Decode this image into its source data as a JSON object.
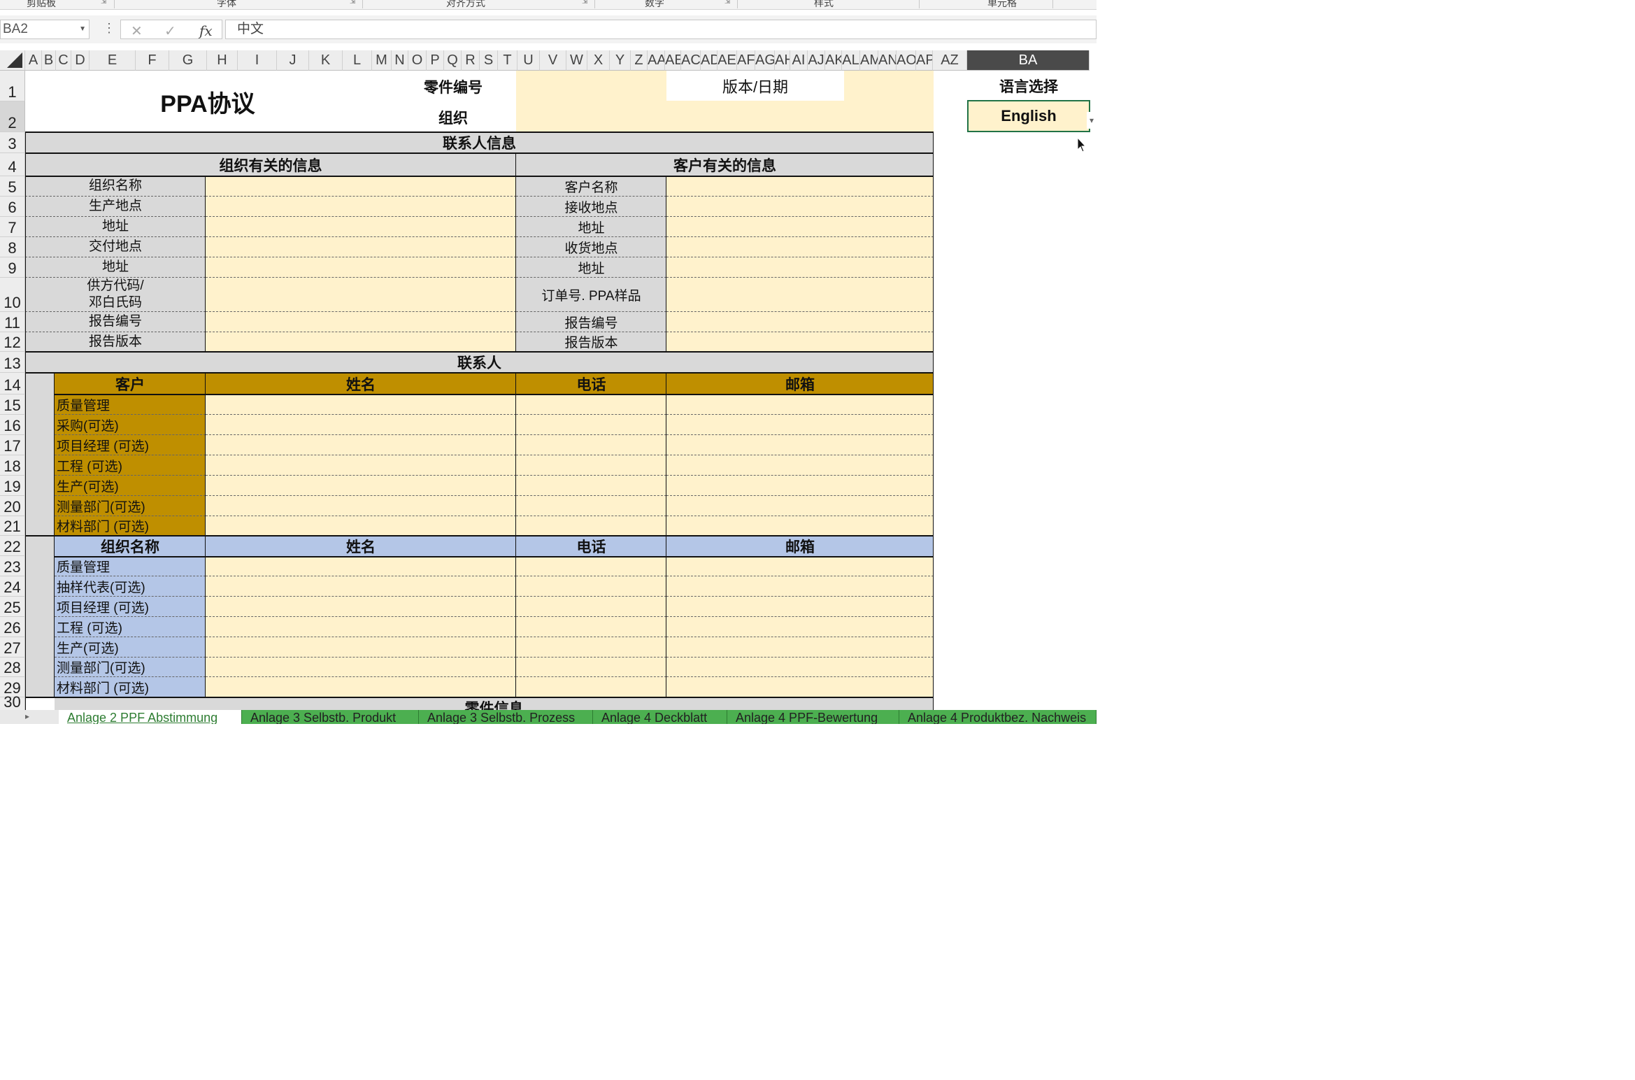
{
  "ribbon": {
    "groups": [
      "剪贴板",
      "字体",
      "对齐方式",
      "数字",
      "样式",
      "单元格"
    ]
  },
  "formula_bar": {
    "name_box": "BA2",
    "content": "中文",
    "fx": "fx"
  },
  "columns": [
    "A",
    "B",
    "C",
    "D",
    "E",
    "F",
    "G",
    "H",
    "I",
    "J",
    "K",
    "L",
    "M",
    "N",
    "O",
    "P",
    "Q",
    "R",
    "S",
    "T",
    "U",
    "V",
    "W",
    "X",
    "Y",
    "Z",
    "AA",
    "AE",
    "AC",
    "AD",
    "AE",
    "AF",
    "AG",
    "AH",
    "AI",
    "AJ",
    "AK",
    "AL",
    "AM",
    "AN",
    "AO",
    "AP",
    "AZ",
    "BA"
  ],
  "rows": [
    "1",
    "2",
    "3",
    "4",
    "5",
    "6",
    "7",
    "8",
    "9",
    "10",
    "11",
    "12",
    "13",
    "14",
    "15",
    "16",
    "17",
    "18",
    "19",
    "20",
    "21",
    "22",
    "23",
    "24",
    "25",
    "26",
    "27",
    "28",
    "29",
    "30"
  ],
  "header": {
    "title": "PPA协议",
    "part_no_label": "零件编号",
    "org_label": "组织",
    "version_label": "版本/日期",
    "lang_label": "语言选择",
    "lang_value": "English"
  },
  "contact_info": {
    "title": "联系人信息",
    "org_header": "组织有关的信息",
    "cust_header": "客户有关的信息",
    "org_fields": [
      "组织名称",
      "生产地点",
      "地址",
      "交付地点",
      "地址",
      "供方代码/\n邓白氏码",
      "报告编号",
      "报告版本"
    ],
    "cust_fields": [
      "客户名称",
      "接收地点",
      "地址",
      "收货地点",
      "地址",
      "订单号. PPA样品",
      "报告编号",
      "报告版本"
    ]
  },
  "contacts": {
    "title": "联系人",
    "customer_table": {
      "headers": [
        "客户",
        "姓名",
        "电话",
        "邮箱"
      ],
      "rows": [
        "质量管理",
        "采购(可选)",
        "项目经理 (可选)",
        "工程 (可选)",
        "生产(可选)",
        "测量部门(可选)",
        "材料部门 (可选)"
      ]
    },
    "org_table": {
      "headers": [
        "组织名称",
        "姓名",
        "电话",
        "邮箱"
      ],
      "rows": [
        "质量管理",
        "抽样代表(可选)",
        "项目经理 (可选)",
        "工程 (可选)",
        "生产(可选)",
        "测量部门(可选)",
        "材料部门 (可选)"
      ]
    }
  },
  "part_info": {
    "title": "零件信息"
  },
  "sheet_tabs": [
    "Anlage 2 PPF Abstimmung",
    "Anlage 3 Selbstb. Produkt",
    "Anlage 3 Selbstb. Prozess",
    "Anlage 4 Deckblatt",
    "Anlage 4 PPF-Bewertung",
    "Anlage 4 Produktbez. Nachweis"
  ],
  "colors": {
    "gold": "#bf8f00",
    "cream": "#fff2cc",
    "blue": "#b4c6e7",
    "gray": "#d9d9d9",
    "tab_green": "#4caf50"
  }
}
